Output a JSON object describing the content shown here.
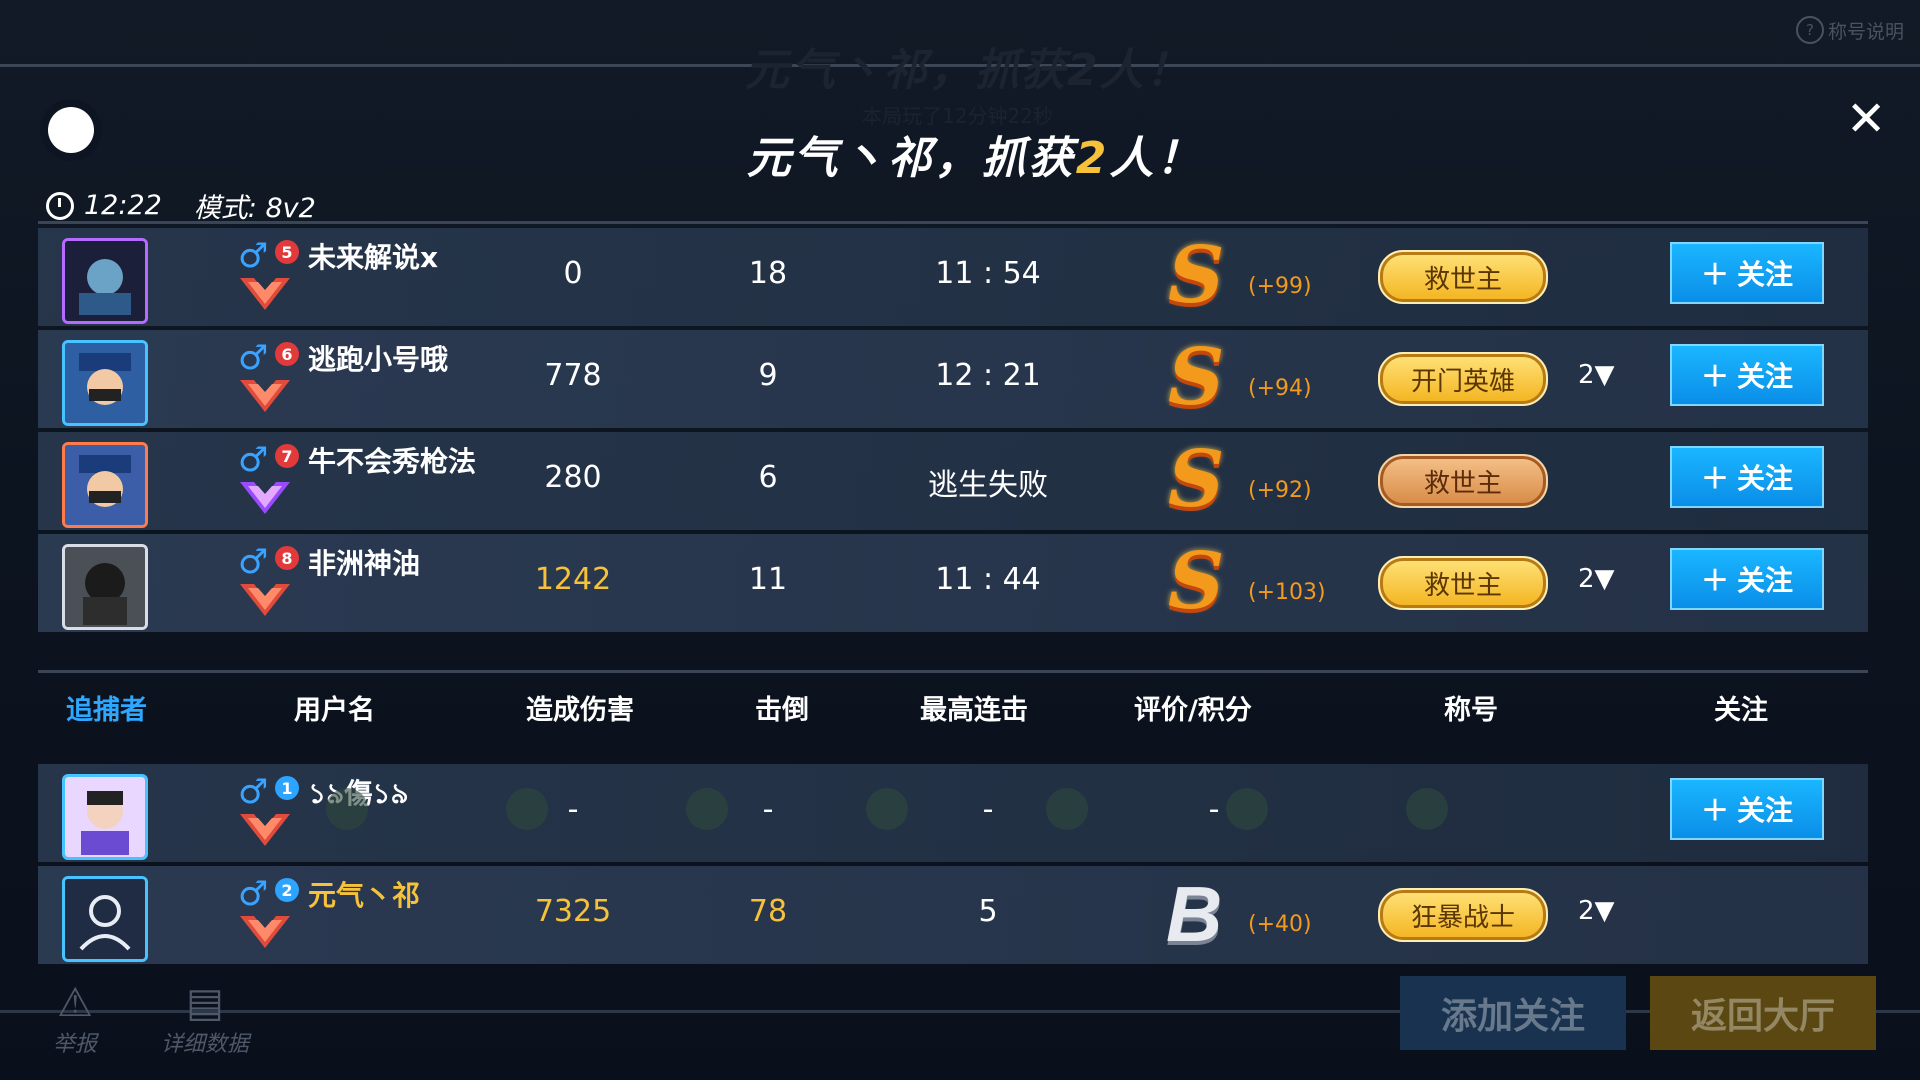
{
  "header": {
    "help_label": "称号说明",
    "title_prefix": "元气丶祁，抓获",
    "title_number": "2",
    "title_suffix": "人！",
    "ghost_title": "元气丶祁，抓获2人！",
    "ghost_sub": "本局玩了12分钟22秒",
    "time": "12:22",
    "mode": "模式: 8v2"
  },
  "escapees": [
    {
      "name": "未来解说x",
      "seat": "5",
      "damage": "0",
      "ko": "18",
      "combo": "11 : 54",
      "grade": "S",
      "points": "(+99)",
      "title": "救世主",
      "title_style": "gold",
      "count": "",
      "follow": "关注"
    },
    {
      "name": "逃跑小号哦",
      "seat": "6",
      "damage": "778",
      "ko": "9",
      "combo": "12 : 21",
      "grade": "S",
      "points": "(+94)",
      "title": "开门英雄",
      "title_style": "gold",
      "count": "2▼",
      "follow": "关注"
    },
    {
      "name": "牛不会秀枪法",
      "seat": "7",
      "damage": "280",
      "ko": "6",
      "combo": "逃生失败",
      "grade": "S",
      "points": "(+92)",
      "title": "救世主",
      "title_style": "bronze",
      "count": "",
      "follow": "关注"
    },
    {
      "name": "非洲神油",
      "seat": "8",
      "damage": "1242",
      "ko": "11",
      "combo": "11 : 44",
      "grade": "S",
      "points": "(+103)",
      "title": "救世主",
      "title_style": "gold",
      "count": "2▼",
      "follow": "关注"
    }
  ],
  "columns": {
    "team": "追捕者",
    "username": "用户名",
    "damage": "造成伤害",
    "ko": "击倒",
    "combo": "最高连击",
    "grade": "评价/积分",
    "title": "称号",
    "follow": "关注"
  },
  "chasers": [
    {
      "name": "১৯傷১৯",
      "seat": "1",
      "damage": "-",
      "ko": "-",
      "combo": "-",
      "grade": "-",
      "follow": "关注"
    },
    {
      "name": "元气丶祁",
      "seat": "2",
      "damage": "7325",
      "ko": "78",
      "combo": "5",
      "grade": "B",
      "points": "(+40)",
      "title": "狂暴战士",
      "count": "2▼"
    }
  ],
  "footer": {
    "report": "举报",
    "details": "详细数据",
    "add_follow": "添加关注",
    "back_lobby": "返回大厅"
  }
}
